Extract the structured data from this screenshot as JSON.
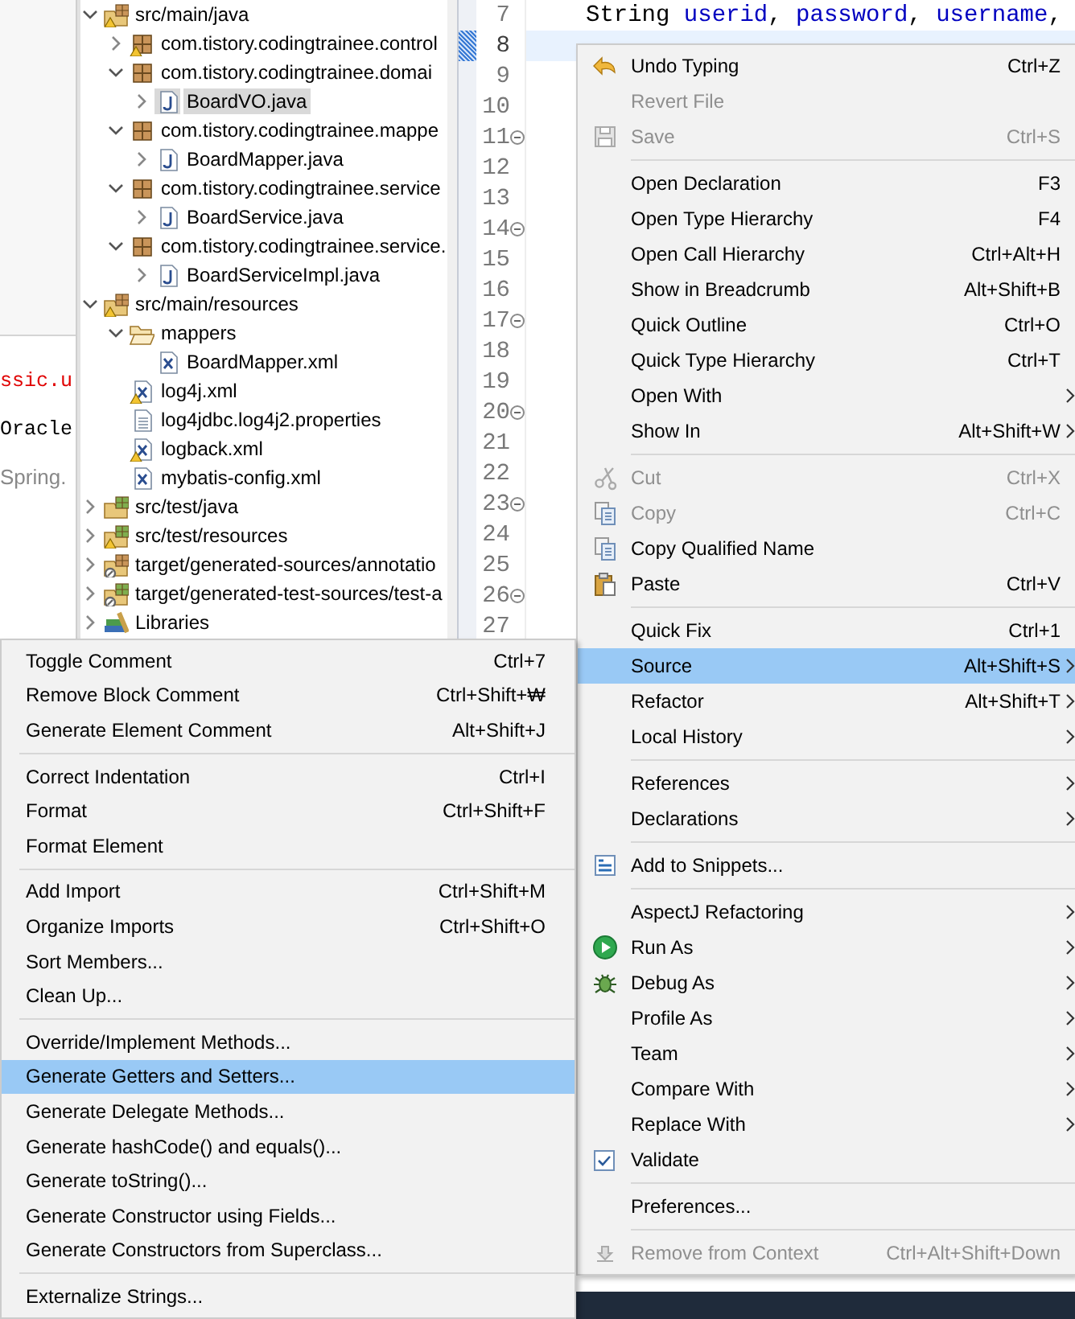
{
  "console": {
    "lines": [
      {
        "text": "ssic.u",
        "kind": "error"
      },
      {
        "text": "Oracle",
        "kind": "plain"
      },
      {
        "text": "Spring.",
        "kind": "info"
      }
    ]
  },
  "package_explorer": {
    "tree": [
      {
        "label": "src/main/java",
        "kind": "source-folder",
        "warning": true,
        "expanded": true,
        "selected": false,
        "children": [
          {
            "label": "com.tistory.codingtrainee.control",
            "kind": "package",
            "warning": true,
            "expanded": false,
            "selected": false
          },
          {
            "label": "com.tistory.codingtrainee.domai",
            "kind": "package",
            "warning": false,
            "expanded": true,
            "selected": false,
            "children": [
              {
                "label": "BoardVO.java",
                "kind": "java-file",
                "warning": false,
                "expanded": false,
                "selected": true
              }
            ]
          },
          {
            "label": "com.tistory.codingtrainee.mappe",
            "kind": "package",
            "warning": false,
            "expanded": true,
            "selected": false,
            "children": [
              {
                "label": "BoardMapper.java",
                "kind": "java-file",
                "warning": false,
                "expanded": false,
                "selected": false
              }
            ]
          },
          {
            "label": "com.tistory.codingtrainee.service",
            "kind": "package",
            "warning": false,
            "expanded": true,
            "selected": false,
            "children": [
              {
                "label": "BoardService.java",
                "kind": "java-file",
                "warning": false,
                "expanded": false,
                "selected": false
              }
            ]
          },
          {
            "label": "com.tistory.codingtrainee.service.",
            "kind": "package",
            "warning": false,
            "expanded": true,
            "selected": false,
            "children": [
              {
                "label": "BoardServiceImpl.java",
                "kind": "java-file",
                "warning": false,
                "expanded": false,
                "selected": false
              }
            ]
          }
        ]
      },
      {
        "label": "src/main/resources",
        "kind": "source-folder",
        "warning": true,
        "expanded": true,
        "selected": false,
        "children": [
          {
            "label": "mappers",
            "kind": "folder",
            "warning": false,
            "expanded": true,
            "selected": false,
            "children": [
              {
                "label": "BoardMapper.xml",
                "kind": "xml-file",
                "warning": false,
                "selected": false
              }
            ]
          },
          {
            "label": "log4j.xml",
            "kind": "xml-file",
            "warning": true,
            "selected": false
          },
          {
            "label": "log4jdbc.log4j2.properties",
            "kind": "text-file",
            "warning": false,
            "selected": false
          },
          {
            "label": "logback.xml",
            "kind": "xml-file",
            "warning": true,
            "selected": false
          },
          {
            "label": "mybatis-config.xml",
            "kind": "xml-file",
            "warning": false,
            "selected": false
          }
        ]
      },
      {
        "label": "src/test/java",
        "kind": "test-source-folder",
        "warning": false,
        "expanded": false,
        "selected": false
      },
      {
        "label": "src/test/resources",
        "kind": "test-source-folder",
        "warning": true,
        "expanded": false,
        "selected": false
      },
      {
        "label": "target/generated-sources/annotatio",
        "kind": "generated-source-folder",
        "warning": false,
        "expanded": false,
        "selected": false
      },
      {
        "label": "target/generated-test-sources/test-a",
        "kind": "generated-test-source-folder",
        "warning": false,
        "expanded": false,
        "selected": false
      },
      {
        "label": "Libraries",
        "kind": "library",
        "warning": false,
        "expanded": false,
        "selected": false
      }
    ]
  },
  "editor": {
    "lines": [
      {
        "number": "7",
        "fold": false,
        "current": false,
        "tokens": [
          {
            "text": "String ",
            "kind": "plain"
          },
          {
            "text": "userid",
            "kind": "field"
          },
          {
            "text": ", ",
            "kind": "plain"
          },
          {
            "text": "password",
            "kind": "field"
          },
          {
            "text": ", ",
            "kind": "plain"
          },
          {
            "text": "username",
            "kind": "field"
          },
          {
            "text": ",",
            "kind": "plain"
          }
        ]
      },
      {
        "number": "8",
        "fold": false,
        "current": true
      },
      {
        "number": "9",
        "fold": false,
        "current": false
      },
      {
        "number": "10",
        "fold": false,
        "current": false
      },
      {
        "number": "11",
        "fold": true,
        "current": false
      },
      {
        "number": "12",
        "fold": false,
        "current": false
      },
      {
        "number": "13",
        "fold": false,
        "current": false
      },
      {
        "number": "14",
        "fold": true,
        "current": false
      },
      {
        "number": "15",
        "fold": false,
        "current": false
      },
      {
        "number": "16",
        "fold": false,
        "current": false
      },
      {
        "number": "17",
        "fold": true,
        "current": false
      },
      {
        "number": "18",
        "fold": false,
        "current": false
      },
      {
        "number": "19",
        "fold": false,
        "current": false
      },
      {
        "number": "20",
        "fold": true,
        "current": false
      },
      {
        "number": "21",
        "fold": false,
        "current": false
      },
      {
        "number": "22",
        "fold": false,
        "current": false
      },
      {
        "number": "23",
        "fold": true,
        "current": false
      },
      {
        "number": "24",
        "fold": false,
        "current": false
      },
      {
        "number": "25",
        "fold": false,
        "current": false
      },
      {
        "number": "26",
        "fold": true,
        "current": false
      },
      {
        "number": "27",
        "fold": false,
        "current": false
      }
    ]
  },
  "context_menu": {
    "items": [
      {
        "kind": "item",
        "label": "Undo Typing",
        "shortcut": "Ctrl+Z",
        "disabled": false,
        "selected": false,
        "submenu": false,
        "checked": false
      },
      {
        "kind": "item",
        "label": "Revert File",
        "disabled": true,
        "selected": false,
        "submenu": false,
        "checked": false
      },
      {
        "kind": "item",
        "label": "Save",
        "shortcut": "Ctrl+S",
        "disabled": true,
        "selected": false,
        "submenu": false,
        "checked": false
      },
      {
        "kind": "separator"
      },
      {
        "kind": "item",
        "label": "Open Declaration",
        "shortcut": "F3",
        "disabled": false,
        "selected": false,
        "submenu": false,
        "checked": false
      },
      {
        "kind": "item",
        "label": "Open Type Hierarchy",
        "shortcut": "F4",
        "disabled": false,
        "selected": false,
        "submenu": false,
        "checked": false
      },
      {
        "kind": "item",
        "label": "Open Call Hierarchy",
        "shortcut": "Ctrl+Alt+H",
        "disabled": false,
        "selected": false,
        "submenu": false,
        "checked": false
      },
      {
        "kind": "item",
        "label": "Show in Breadcrumb",
        "shortcut": "Alt+Shift+B",
        "disabled": false,
        "selected": false,
        "submenu": false,
        "checked": false
      },
      {
        "kind": "item",
        "label": "Quick Outline",
        "shortcut": "Ctrl+O",
        "disabled": false,
        "selected": false,
        "submenu": false,
        "checked": false
      },
      {
        "kind": "item",
        "label": "Quick Type Hierarchy",
        "shortcut": "Ctrl+T",
        "disabled": false,
        "selected": false,
        "submenu": false,
        "checked": false
      },
      {
        "kind": "item",
        "label": "Open With",
        "disabled": false,
        "selected": false,
        "submenu": true,
        "checked": false
      },
      {
        "kind": "item",
        "label": "Show In",
        "shortcut": "Alt+Shift+W",
        "disabled": false,
        "selected": false,
        "submenu": true,
        "checked": false
      },
      {
        "kind": "separator"
      },
      {
        "kind": "item",
        "label": "Cut",
        "shortcut": "Ctrl+X",
        "disabled": true,
        "selected": false,
        "submenu": false,
        "checked": false
      },
      {
        "kind": "item",
        "label": "Copy",
        "shortcut": "Ctrl+C",
        "disabled": true,
        "selected": false,
        "submenu": false,
        "checked": false
      },
      {
        "kind": "item",
        "label": "Copy Qualified Name",
        "disabled": false,
        "selected": false,
        "submenu": false,
        "checked": false
      },
      {
        "kind": "item",
        "label": "Paste",
        "shortcut": "Ctrl+V",
        "disabled": false,
        "selected": false,
        "submenu": false,
        "checked": false
      },
      {
        "kind": "separator"
      },
      {
        "kind": "item",
        "label": "Quick Fix",
        "shortcut": "Ctrl+1",
        "disabled": false,
        "selected": false,
        "submenu": false,
        "checked": false
      },
      {
        "kind": "item",
        "label": "Source",
        "shortcut": "Alt+Shift+S",
        "disabled": false,
        "selected": true,
        "submenu": true,
        "checked": false
      },
      {
        "kind": "item",
        "label": "Refactor",
        "shortcut": "Alt+Shift+T",
        "disabled": false,
        "selected": false,
        "submenu": true,
        "checked": false
      },
      {
        "kind": "item",
        "label": "Local History",
        "disabled": false,
        "selected": false,
        "submenu": true,
        "checked": false
      },
      {
        "kind": "separator"
      },
      {
        "kind": "item",
        "label": "References",
        "disabled": false,
        "selected": false,
        "submenu": true,
        "checked": false
      },
      {
        "kind": "item",
        "label": "Declarations",
        "disabled": false,
        "selected": false,
        "submenu": true,
        "checked": false
      },
      {
        "kind": "separator"
      },
      {
        "kind": "item",
        "label": "Add to Snippets...",
        "disabled": false,
        "selected": false,
        "submenu": false,
        "checked": false
      },
      {
        "kind": "separator"
      },
      {
        "kind": "item",
        "label": "AspectJ Refactoring",
        "disabled": false,
        "selected": false,
        "submenu": true,
        "checked": false
      },
      {
        "kind": "item",
        "label": "Run As",
        "disabled": false,
        "selected": false,
        "submenu": true,
        "checked": false
      },
      {
        "kind": "item",
        "label": "Debug As",
        "disabled": false,
        "selected": false,
        "submenu": true,
        "checked": false
      },
      {
        "kind": "item",
        "label": "Profile As",
        "disabled": false,
        "selected": false,
        "submenu": true,
        "checked": false
      },
      {
        "kind": "item",
        "label": "Team",
        "disabled": false,
        "selected": false,
        "submenu": true,
        "checked": false
      },
      {
        "kind": "item",
        "label": "Compare With",
        "disabled": false,
        "selected": false,
        "submenu": true,
        "checked": false
      },
      {
        "kind": "item",
        "label": "Replace With",
        "disabled": false,
        "selected": false,
        "submenu": true,
        "checked": false
      },
      {
        "kind": "item",
        "label": "Validate",
        "disabled": false,
        "selected": false,
        "submenu": false,
        "checked": true
      },
      {
        "kind": "separator"
      },
      {
        "kind": "item",
        "label": "Preferences...",
        "disabled": false,
        "selected": false,
        "submenu": false,
        "checked": false
      },
      {
        "kind": "separator"
      },
      {
        "kind": "item",
        "label": "Remove from Context",
        "shortcut": "Ctrl+Alt+Shift+Down",
        "disabled": true,
        "selected": false,
        "submenu": false,
        "checked": false
      }
    ]
  },
  "source_submenu": {
    "items": [
      {
        "kind": "item",
        "label": "Toggle Comment",
        "shortcut": "Ctrl+7",
        "selected": false
      },
      {
        "kind": "item",
        "label": "Remove Block Comment",
        "shortcut": "Ctrl+Shift+₩",
        "selected": false
      },
      {
        "kind": "item",
        "label": "Generate Element Comment",
        "shortcut": "Alt+Shift+J",
        "selected": false
      },
      {
        "kind": "separator"
      },
      {
        "kind": "item",
        "label": "Correct Indentation",
        "shortcut": "Ctrl+I",
        "selected": false
      },
      {
        "kind": "item",
        "label": "Format",
        "shortcut": "Ctrl+Shift+F",
        "selected": false
      },
      {
        "kind": "item",
        "label": "Format Element",
        "selected": false
      },
      {
        "kind": "separator"
      },
      {
        "kind": "item",
        "label": "Add Import",
        "shortcut": "Ctrl+Shift+M",
        "selected": false
      },
      {
        "kind": "item",
        "label": "Organize Imports",
        "shortcut": "Ctrl+Shift+O",
        "selected": false
      },
      {
        "kind": "item",
        "label": "Sort Members...",
        "selected": false
      },
      {
        "kind": "item",
        "label": "Clean Up...",
        "selected": false
      },
      {
        "kind": "separator"
      },
      {
        "kind": "item",
        "label": "Override/Implement Methods...",
        "selected": false
      },
      {
        "kind": "item",
        "label": "Generate Getters and Setters...",
        "selected": true
      },
      {
        "kind": "item",
        "label": "Generate Delegate Methods...",
        "selected": false
      },
      {
        "kind": "item",
        "label": "Generate hashCode() and equals()...",
        "selected": false
      },
      {
        "kind": "item",
        "label": "Generate toString()...",
        "selected": false
      },
      {
        "kind": "item",
        "label": "Generate Constructor using Fields...",
        "selected": false
      },
      {
        "kind": "item",
        "label": "Generate Constructors from Superclass...",
        "selected": false
      },
      {
        "kind": "separator"
      },
      {
        "kind": "item",
        "label": "Externalize Strings...",
        "selected": false
      }
    ]
  }
}
